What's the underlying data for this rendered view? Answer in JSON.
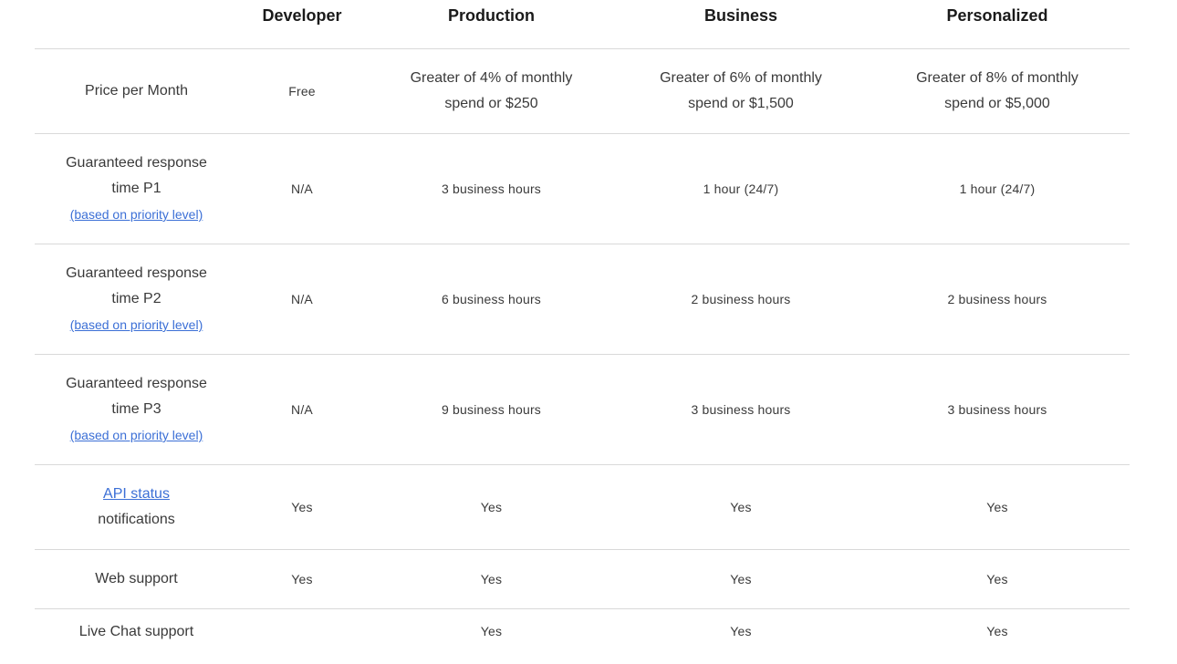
{
  "headers": [
    "Developer",
    "Production",
    "Business",
    "Personalized"
  ],
  "rows": {
    "price": {
      "label": "Price per Month",
      "values": [
        {
          "line1": "Free",
          "line2": ""
        },
        {
          "line1": "Greater of 4% of monthly",
          "line2": "spend or $250"
        },
        {
          "line1": "Greater of 6% of monthly",
          "line2": "spend or $1,500"
        },
        {
          "line1": "Greater of 8% of monthly",
          "line2": "spend or $5,000"
        }
      ]
    },
    "p1": {
      "label_line1": "Guaranteed response",
      "label_line2": "time P1",
      "link": "(based on priority level)",
      "values": [
        "N/A",
        "3 business hours",
        "1 hour (24/7)",
        "1 hour (24/7)"
      ]
    },
    "p2": {
      "label_line1": "Guaranteed response",
      "label_line2": "time P2",
      "link": "(based on priority level)",
      "values": [
        "N/A",
        "6 business hours",
        "2 business hours",
        "2 business hours"
      ]
    },
    "p3": {
      "label_line1": "Guaranteed response",
      "label_line2": "time P3",
      "link": "(based on priority level)",
      "values": [
        "N/A",
        "9 business hours",
        "3 business hours",
        "3 business hours"
      ]
    },
    "api": {
      "label_link": "API status",
      "label_line2": "notifications",
      "values": [
        "Yes",
        "Yes",
        "Yes",
        "Yes"
      ]
    },
    "web": {
      "label": "Web support",
      "values": [
        "Yes",
        "Yes",
        "Yes",
        "Yes"
      ]
    },
    "chat": {
      "label": "Live Chat support",
      "values": [
        "",
        "Yes",
        "Yes",
        "Yes"
      ]
    }
  },
  "colors": {
    "link": "#3b6fd6",
    "divider": "#d9d9d9",
    "text": "#3a3a3a",
    "header_text": "#1a1a1a"
  }
}
